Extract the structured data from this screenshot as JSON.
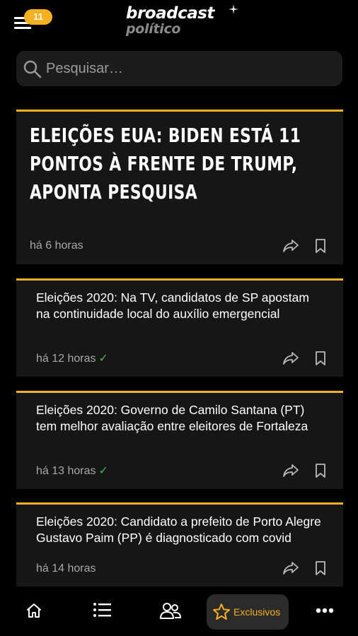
{
  "header": {
    "notification_count": "11",
    "logo_main": "broadcast",
    "logo_sub": "político"
  },
  "search": {
    "placeholder": "Pesquisar…"
  },
  "feed": {
    "featured": {
      "title": "ELEIÇÕES EUA: BIDEN ESTÁ 11 PONTOS À FRENTE DE TRUMP, APONTA PESQUISA",
      "time": "há 6 horas"
    },
    "items": [
      {
        "title": "Eleições 2020: Na TV, candidatos de SP apostam na continuidade local do auxílio emergencial",
        "time": "há 12 horas",
        "read_mark": "✓"
      },
      {
        "title": "Eleições 2020: Governo de Camilo Santana (PT) tem melhor avaliação entre eleitores de Fortaleza",
        "time": "há 13 horas",
        "read_mark": "✓"
      },
      {
        "title": "Eleições 2020: Candidato a prefeito de Porto Alegre Gustavo Paim (PP) é diagnosticado com covid",
        "time": "há 14 horas"
      }
    ]
  },
  "bottom_nav": {
    "items": [
      {
        "icon": "home-icon"
      },
      {
        "icon": "list-icon"
      },
      {
        "icon": "people-icon"
      },
      {
        "icon": "star-icon",
        "label": "Exclusivos",
        "active": true
      },
      {
        "icon": "more-icon"
      }
    ]
  },
  "colors": {
    "accent": "#f5b120",
    "background": "#000000",
    "card": "#161616",
    "read_check": "#4fb34f"
  }
}
